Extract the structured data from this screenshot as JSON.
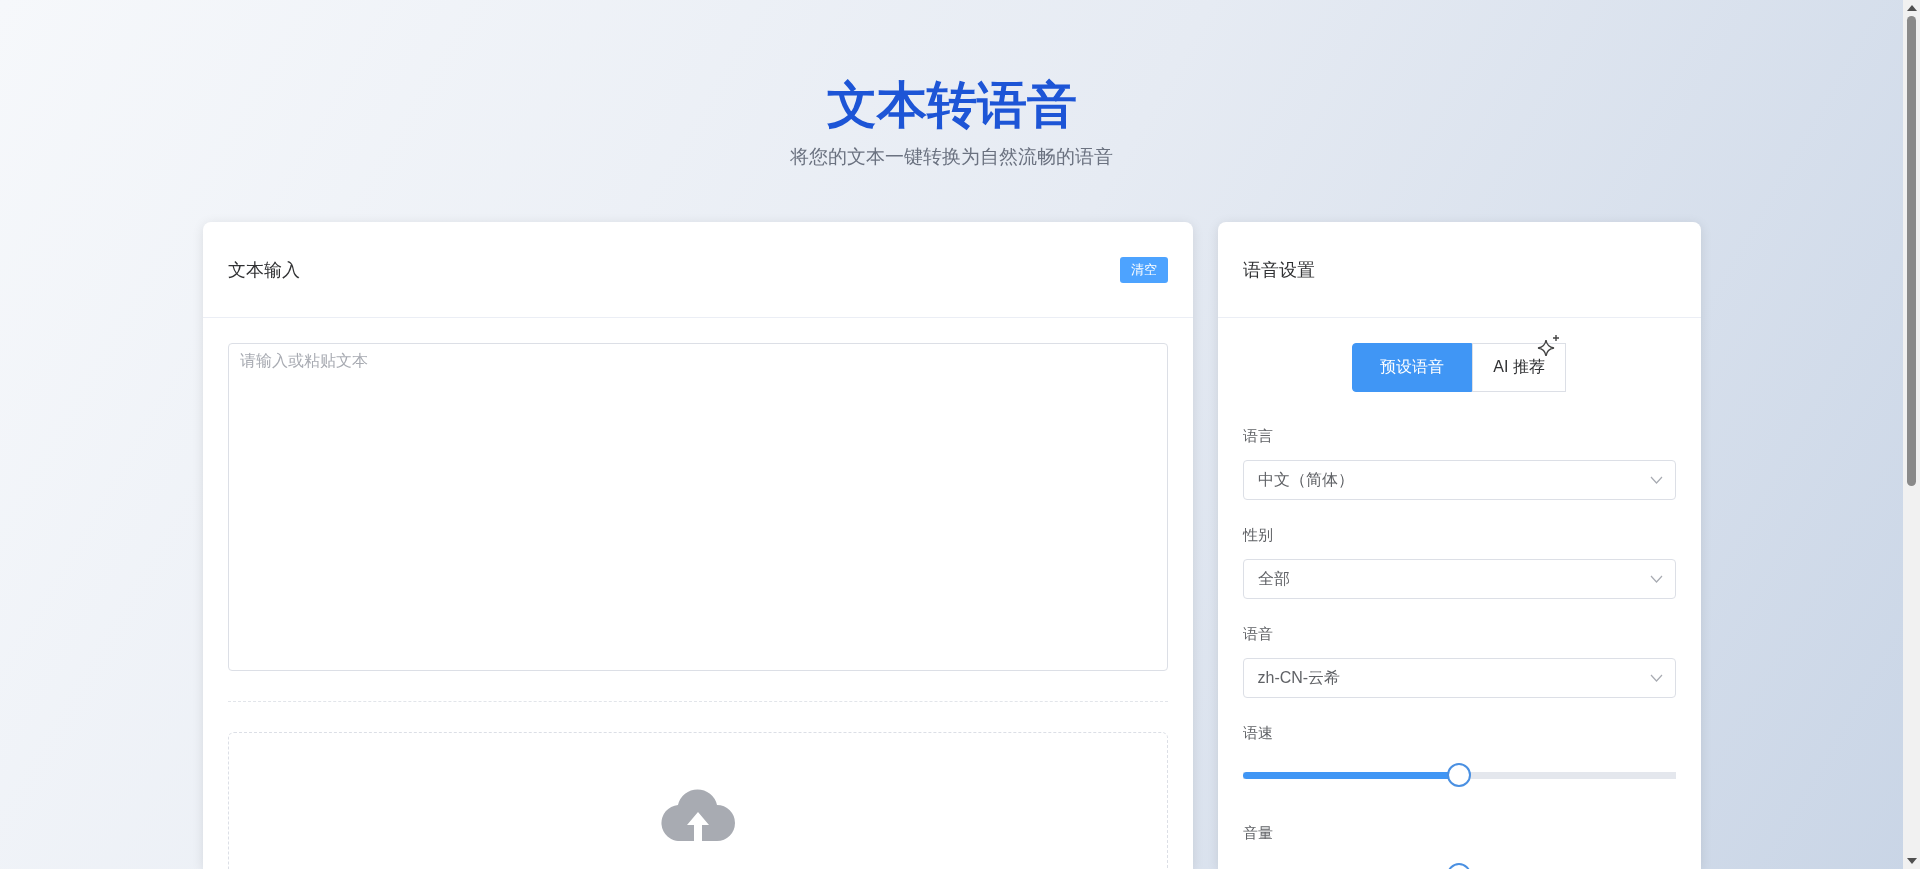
{
  "header": {
    "title": "文本转语音",
    "subtitle": "将您的文本一键转换为自然流畅的语音"
  },
  "text_input": {
    "title": "文本输入",
    "clear_button": "清空",
    "textarea": {
      "placeholder": "请输入或粘贴文本"
    }
  },
  "voice_settings": {
    "title": "语音设置",
    "mode_tabs": [
      {
        "label": "预设语音",
        "selected": true
      },
      {
        "label": "AI 推荐",
        "selected": false
      }
    ],
    "fields": [
      {
        "kind": "select",
        "label": "语言",
        "value": "中文（简体）"
      },
      {
        "kind": "select",
        "label": "性别",
        "value": "全部"
      },
      {
        "kind": "select",
        "label": "语音",
        "value": "zh-CN-云希"
      },
      {
        "kind": "slider",
        "label": "语速",
        "level": 0.5
      },
      {
        "kind": "slider",
        "label": "音量",
        "level": 0.5
      }
    ]
  }
}
